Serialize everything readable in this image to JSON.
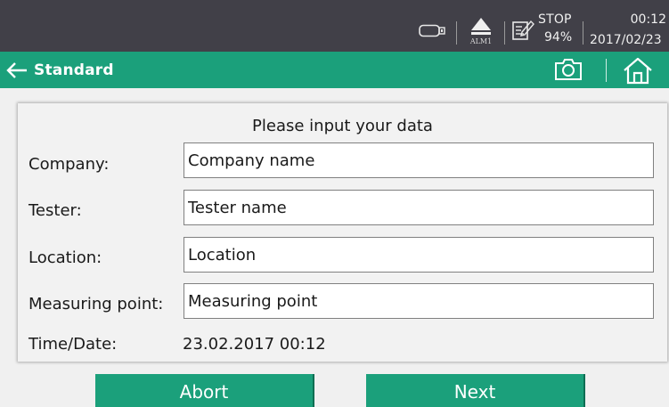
{
  "status_bar": {
    "icons": [
      "usb-icon",
      "alarm-icon",
      "record-icon"
    ],
    "alarm_label": "ALM1",
    "record_status": "STOP",
    "battery_level": "94%",
    "time": "00:12",
    "date": "2017/02/23"
  },
  "title_bar": {
    "back_icon": "arrow-left-icon",
    "title": "Standard",
    "camera_icon": "camera-icon",
    "home_icon": "home-icon"
  },
  "form": {
    "heading": "Please input your data",
    "company": {
      "label": "Company:",
      "value": "Company name"
    },
    "tester": {
      "label": "Tester:",
      "value": "Tester name"
    },
    "location": {
      "label": "Location:",
      "value": "Location"
    },
    "measuring_point": {
      "label": "Measuring point:",
      "value": "Measuring point"
    },
    "time_date": {
      "label": "Time/Date:",
      "value": "23.02.2017 00:12"
    }
  },
  "buttons": {
    "abort_label": "Abort",
    "next_label": "Next"
  },
  "colors": {
    "status_bar_bg": "#414048",
    "accent_green": "#1ba07b",
    "panel_bg": "#f2f2f2",
    "field_border": "#808080"
  }
}
